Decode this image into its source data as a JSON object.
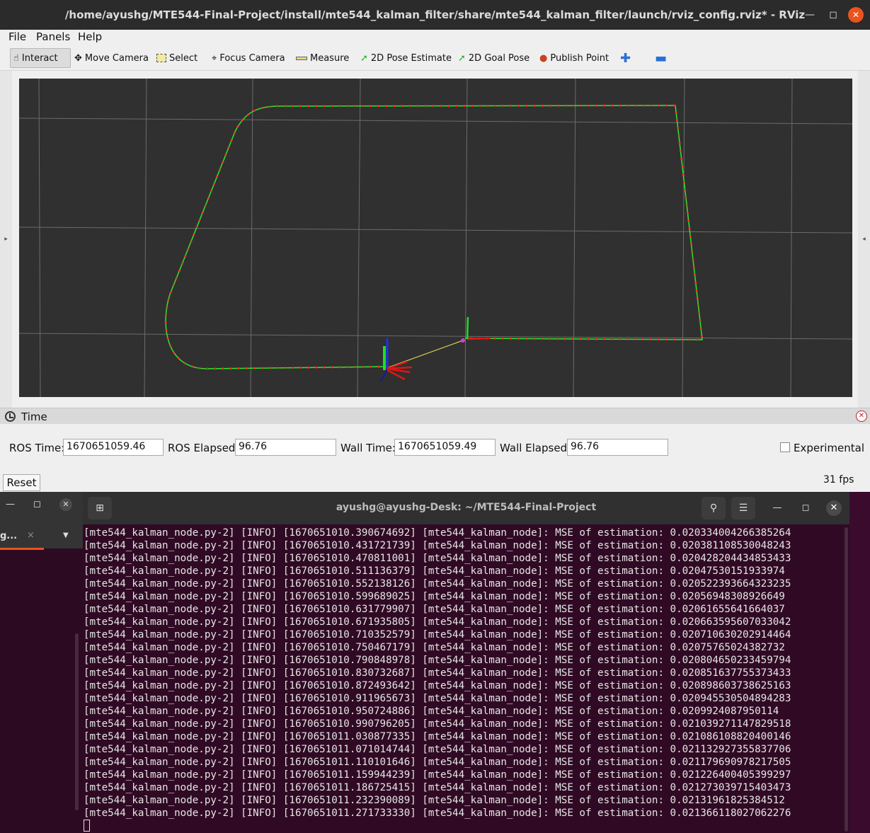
{
  "rviz": {
    "title": "/home/ayushg/MTE544-Final-Project/install/mte544_kalman_filter/share/mte544_kalman_filter/launch/rviz_config.rviz* - RViz",
    "menu": [
      "File",
      "Panels",
      "Help"
    ],
    "toolbar": [
      {
        "label": "Interact",
        "icon": "hand-pointer-icon"
      },
      {
        "label": "Move Camera",
        "icon": "move-icon"
      },
      {
        "label": "Select",
        "icon": "select-box-icon"
      },
      {
        "label": "Focus Camera",
        "icon": "focus-icon"
      },
      {
        "label": "Measure",
        "icon": "ruler-icon"
      },
      {
        "label": "2D Pose Estimate",
        "icon": "green-arrow-icon"
      },
      {
        "label": "2D Goal Pose",
        "icon": "green-arrow-icon"
      },
      {
        "label": "Publish Point",
        "icon": "map-pin-icon"
      }
    ],
    "time_panel": {
      "title": "Time",
      "ros_time_label": "ROS Time:",
      "ros_time": "1670651059.46",
      "ros_elapsed_label": "ROS Elapsed:",
      "ros_elapsed": "96.76",
      "wall_time_label": "Wall Time:",
      "wall_time": "1670651059.49",
      "wall_elapsed_label": "Wall Elapsed:",
      "wall_elapsed": "96.76",
      "experimental_label": "Experimental",
      "reset_label": "Reset",
      "fps": "31 fps"
    },
    "colors": {
      "path_true": "#22dd22",
      "path_est": "#ff2020",
      "grid": "#6a6a6a",
      "viewport_bg": "#303030"
    }
  },
  "left_terminal": {
    "tab_label": "g...",
    "tab_close": "×"
  },
  "terminal": {
    "title": "ayushg@ayushg-Desk: ~/MTE544-Final-Project",
    "lines": [
      "[mte544_kalman_node.py-2] [INFO] [1670651010.390674692] [mte544_kalman_node]: MSE of estimation: 0.020334004266385264",
      "[mte544_kalman_node.py-2] [INFO] [1670651010.431721739] [mte544_kalman_node]: MSE of estimation: 0.020381108530048243",
      "[mte544_kalman_node.py-2] [INFO] [1670651010.470811001] [mte544_kalman_node]: MSE of estimation: 0.020428204434853433",
      "[mte544_kalman_node.py-2] [INFO] [1670651010.511136379] [mte544_kalman_node]: MSE of estimation: 0.02047530151933974",
      "[mte544_kalman_node.py-2] [INFO] [1670651010.552138126] [mte544_kalman_node]: MSE of estimation: 0.020522393664323235",
      "[mte544_kalman_node.py-2] [INFO] [1670651010.599689025] [mte544_kalman_node]: MSE of estimation: 0.02056948308926649",
      "[mte544_kalman_node.py-2] [INFO] [1670651010.631779907] [mte544_kalman_node]: MSE of estimation: 0.02061655641664037",
      "[mte544_kalman_node.py-2] [INFO] [1670651010.671935805] [mte544_kalman_node]: MSE of estimation: 0.020663595607033042",
      "[mte544_kalman_node.py-2] [INFO] [1670651010.710352579] [mte544_kalman_node]: MSE of estimation: 0.020710630202914464",
      "[mte544_kalman_node.py-2] [INFO] [1670651010.750467179] [mte544_kalman_node]: MSE of estimation: 0.02075765024382732",
      "[mte544_kalman_node.py-2] [INFO] [1670651010.790848978] [mte544_kalman_node]: MSE of estimation: 0.020804650233459794",
      "[mte544_kalman_node.py-2] [INFO] [1670651010.830732687] [mte544_kalman_node]: MSE of estimation: 0.020851637755373433",
      "[mte544_kalman_node.py-2] [INFO] [1670651010.872493642] [mte544_kalman_node]: MSE of estimation: 0.020898603738625163",
      "[mte544_kalman_node.py-2] [INFO] [1670651010.911965673] [mte544_kalman_node]: MSE of estimation: 0.020945530504894283",
      "[mte544_kalman_node.py-2] [INFO] [1670651010.950724886] [mte544_kalman_node]: MSE of estimation: 0.0209924087950114",
      "[mte544_kalman_node.py-2] [INFO] [1670651010.990796205] [mte544_kalman_node]: MSE of estimation: 0.021039271147829518",
      "[mte544_kalman_node.py-2] [INFO] [1670651011.030877335] [mte544_kalman_node]: MSE of estimation: 0.021086108820400146",
      "[mte544_kalman_node.py-2] [INFO] [1670651011.071014744] [mte544_kalman_node]: MSE of estimation: 0.021132927355837706",
      "[mte544_kalman_node.py-2] [INFO] [1670651011.110101646] [mte544_kalman_node]: MSE of estimation: 0.021179690978217505",
      "[mte544_kalman_node.py-2] [INFO] [1670651011.159944239] [mte544_kalman_node]: MSE of estimation: 0.021226400405399297",
      "[mte544_kalman_node.py-2] [INFO] [1670651011.186725415] [mte544_kalman_node]: MSE of estimation: 0.021273039715403473",
      "[mte544_kalman_node.py-2] [INFO] [1670651011.232390089] [mte544_kalman_node]: MSE of estimation: 0.02131961825384512",
      "[mte544_kalman_node.py-2] [INFO] [1670651011.271733330] [mte544_kalman_node]: MSE of estimation: 0.021366118027062276"
    ]
  }
}
